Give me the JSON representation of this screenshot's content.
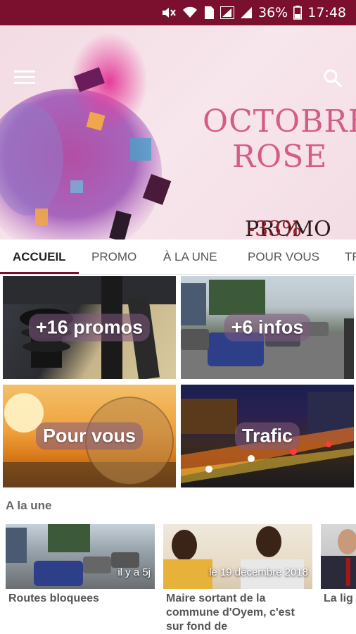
{
  "status_bar": {
    "battery": "36%",
    "time": "17:48",
    "sim_badge": "1"
  },
  "hero": {
    "title_line1": "OCTOBRE",
    "title_line2": "ROSE",
    "promo": "PROMO",
    "discount": "-33%"
  },
  "tabs": [
    "ACCUEIL",
    "PROMO",
    "À LA UNE",
    "POUR VOUS",
    "TR"
  ],
  "active_tab": 0,
  "tiles": [
    {
      "label": "+16 promos"
    },
    {
      "label": "+6 infos"
    },
    {
      "label": "Pour vous"
    },
    {
      "label": "Trafic"
    }
  ],
  "section": {
    "title": "A la une"
  },
  "cards": [
    {
      "date": "il y a 5j",
      "title": "Routes bloquees"
    },
    {
      "date": "le 19 décembre 2018",
      "title": "Maire sortant de la commune d'Oyem, c'est sur fond de"
    },
    {
      "date": "",
      "title": "La lig hauteu Turin"
    }
  ],
  "colors": {
    "brand": "#7a0f2e",
    "hero_accent": "#d45d86"
  },
  "icons": [
    "mute-icon",
    "wifi-icon",
    "sim-icon",
    "signal-icon",
    "battery-icon",
    "menu-icon",
    "search-icon"
  ]
}
